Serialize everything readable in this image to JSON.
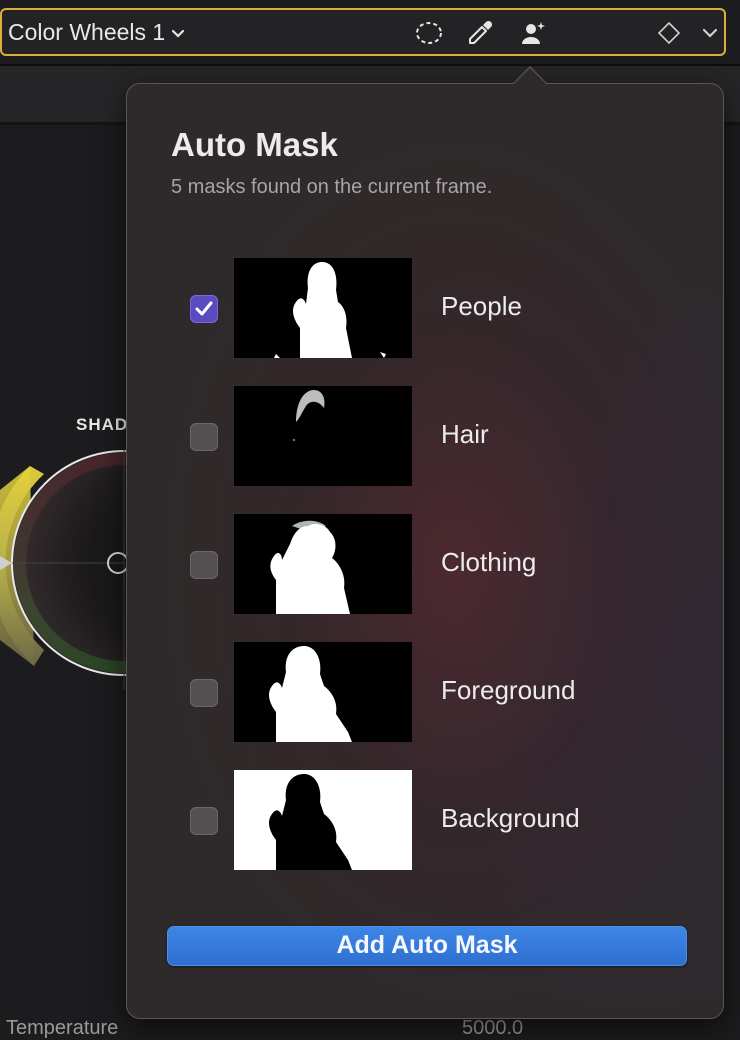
{
  "header": {
    "effect_name": "Color Wheels 1",
    "icons": [
      "mask-circle-icon",
      "eyedropper-icon",
      "auto-mask-person-icon",
      "keyframe-diamond-icon",
      "chevron-down-icon"
    ]
  },
  "background": {
    "wheel_label": "SHAD",
    "parameter_name": "Temperature",
    "parameter_value": "5000.0"
  },
  "popover": {
    "title": "Auto Mask",
    "subtitle": "5 masks found on the current frame.",
    "masks": [
      {
        "label": "People",
        "checked": true,
        "thumb": "people"
      },
      {
        "label": "Hair",
        "checked": false,
        "thumb": "hair"
      },
      {
        "label": "Clothing",
        "checked": false,
        "thumb": "clothing"
      },
      {
        "label": "Foreground",
        "checked": false,
        "thumb": "people"
      },
      {
        "label": "Background",
        "checked": false,
        "thumb": "background"
      }
    ],
    "add_button_label": "Add Auto Mask"
  },
  "colors": {
    "header_border": "#d9ae3c",
    "checkbox_checked": "#5b4bc0",
    "button_blue": "#2f6fd0"
  }
}
